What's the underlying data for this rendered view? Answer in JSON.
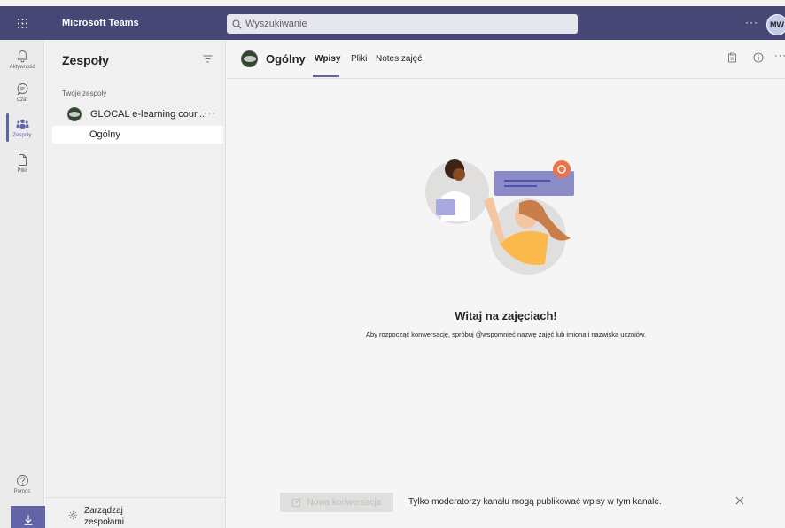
{
  "topbar": {
    "app_title": "Microsoft Teams",
    "search_placeholder": "Wyszukiwanie",
    "more_label": "···",
    "avatar_initials": "MW"
  },
  "rail": {
    "items": [
      {
        "label": "Aktywność",
        "icon": "bell-icon"
      },
      {
        "label": "Czat",
        "icon": "chat-icon"
      },
      {
        "label": "Zespoły",
        "icon": "teams-icon",
        "active": true
      },
      {
        "label": "Pliki",
        "icon": "file-icon"
      }
    ],
    "help_label": "Pomoc",
    "download_icon": "download-icon"
  },
  "teams_panel": {
    "title": "Zespoły",
    "section_label": "Twoje zespoły",
    "team_name": "GLOCAL e-learning cour...",
    "team_more": "···",
    "channel_name": "Ogólny",
    "manage_label_line1": "Zarządzaj",
    "manage_label_line2": "zespołami"
  },
  "main": {
    "channel_title": "Ogólny",
    "tabs": [
      "Wpisy",
      "Pliki",
      "Notes zajęć"
    ],
    "active_tab": "Wpisy",
    "more_label": "···",
    "welcome_title": "Witaj na zajęciach!",
    "welcome_subtitle": "Aby rozpocząć konwersację, spróbuj @wspomnieć nazwę zajęć lub imiona i nazwiska uczniów.",
    "new_conversation_label": "Nowa konwersacja",
    "moderator_note": "Tylko moderatorzy kanału mogą publikować wpisy w tym kanale."
  },
  "colors": {
    "brand": "#464775",
    "accent": "#6264a7",
    "background": "#f5f5f5"
  }
}
